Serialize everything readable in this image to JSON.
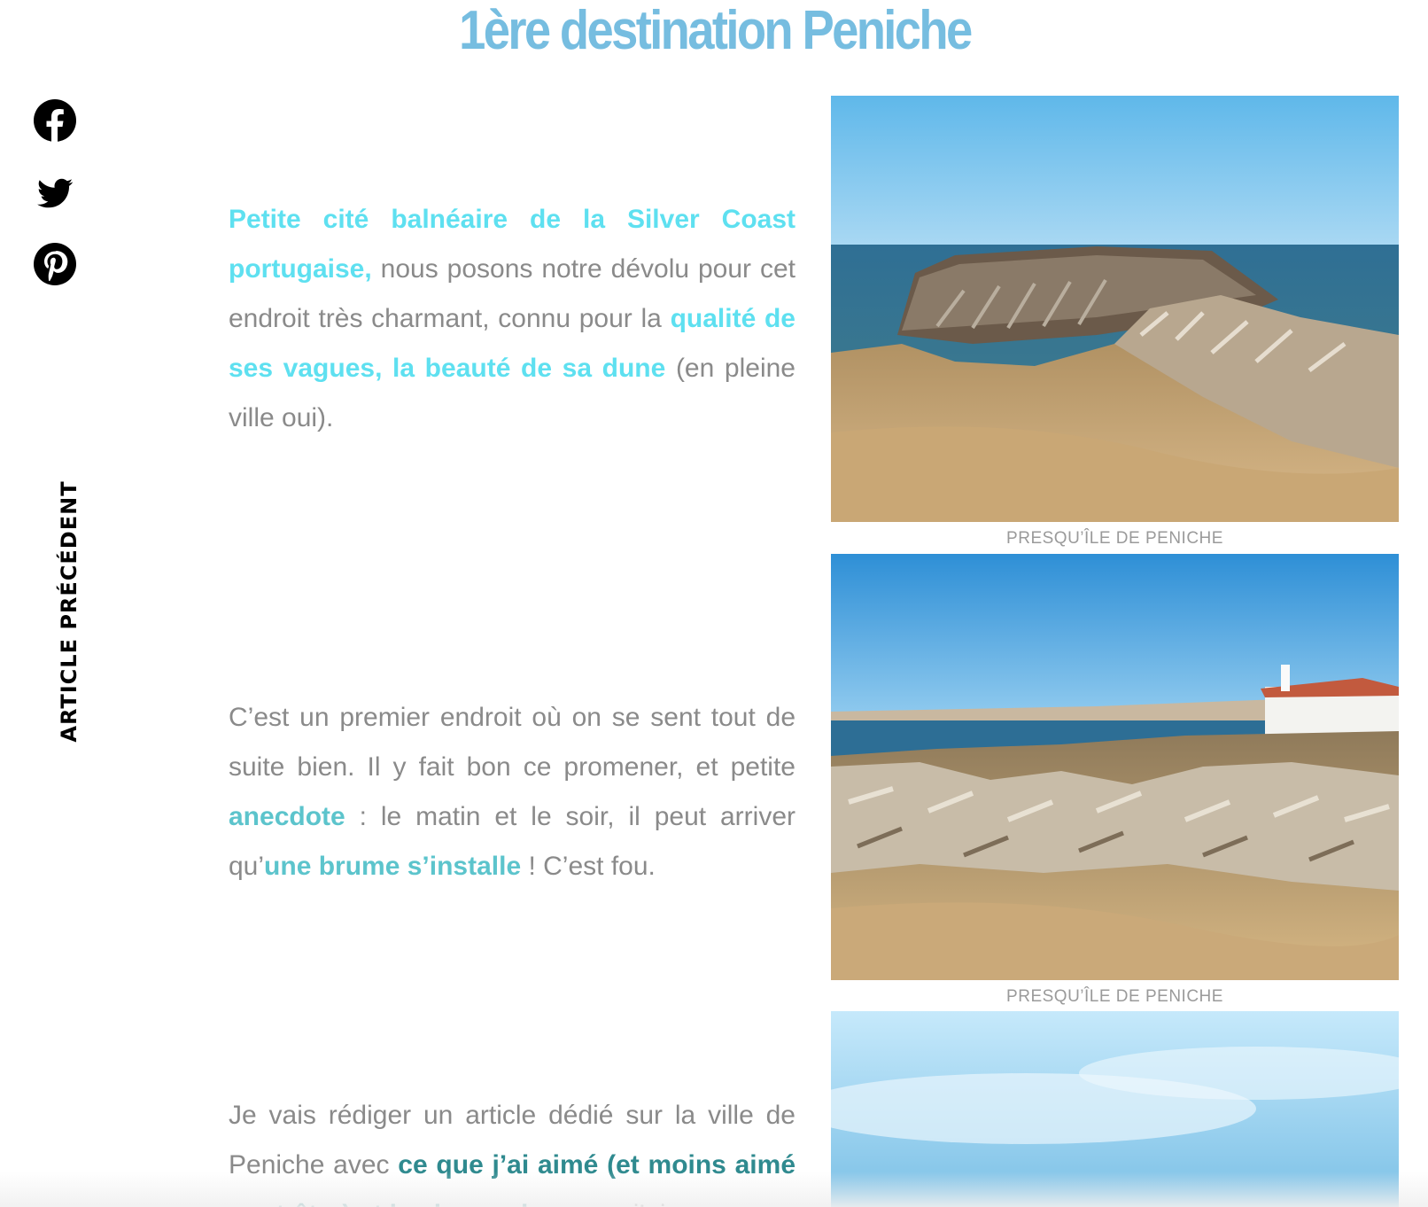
{
  "title": "1ère destination Peniche",
  "social": {
    "facebook_icon": "facebook-icon",
    "twitter_icon": "twitter-icon",
    "pinterest_icon": "pinterest-icon"
  },
  "nav": {
    "previous_article": "ARTICLE PRÉCÉDENT"
  },
  "paragraphs": {
    "p1": {
      "h1": "Petite cité balnéaire de la Silver Coast portugaise,",
      "t1": " nous posons notre dévolu pour cet endroit très charmant, connu pour la ",
      "h2": "qualité de ses vagues, la beauté de sa dune",
      "t2": " (en pleine ville oui)."
    },
    "p2": {
      "t1": "C’est un premier endroit où on se sent tout de suite bien. Il y fait bon ce promener, et petite ",
      "h1": "anecdote",
      "t2": " : le matin et le soir, il peut arriver qu’",
      "h2": "une brume s’installe",
      "t3": " ! C’est fou."
    },
    "p3": {
      "t1": "Je vais rédiger un article dédié sur la ville de Peniche avec ",
      "h1": "ce que j’ai aimé (et moins aimé peut-être) et les bons plans",
      "t2": " que j’ai"
    }
  },
  "captions": {
    "photo1": "PRESQU’ÎLE DE PENICHE",
    "photo2": "PRESQU’ÎLE DE PENICHE"
  },
  "colors": {
    "title": "#76bde0",
    "highlight_cyan": "#5ee0f0",
    "highlight_teal": "#5cc4cc",
    "highlight_dark_teal": "#2f8a8f",
    "body_text": "#8a8a8a"
  }
}
